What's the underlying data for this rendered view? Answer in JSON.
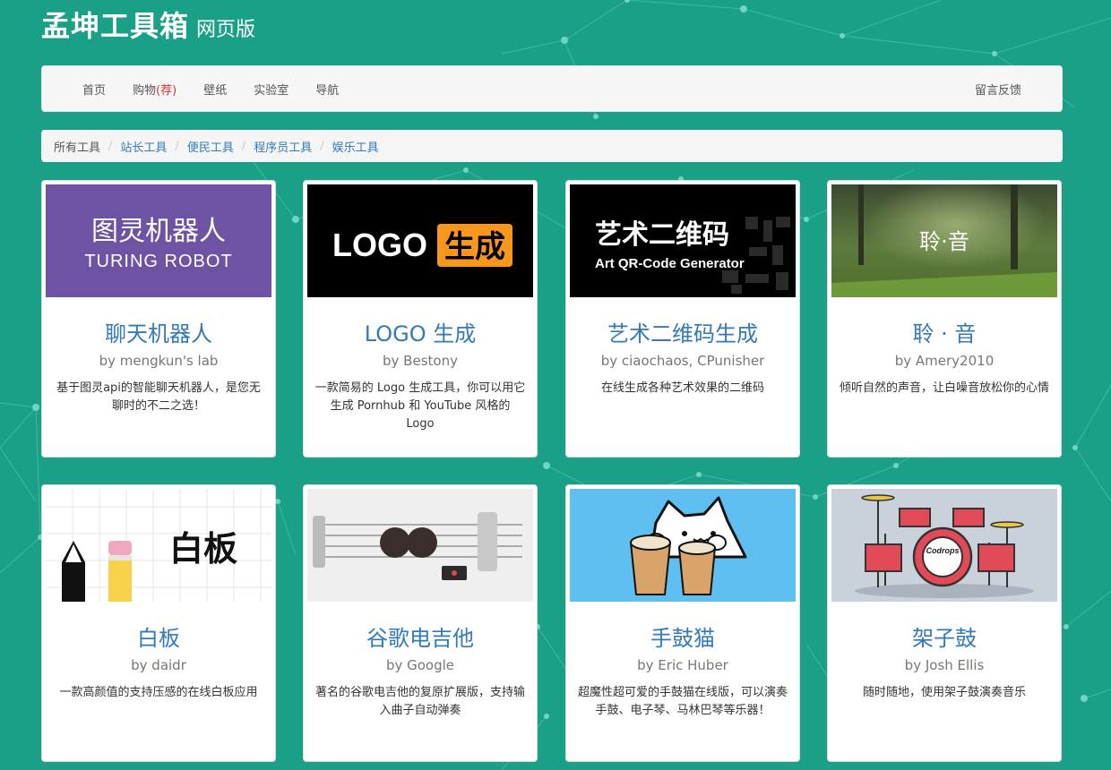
{
  "header": {
    "title": "孟坤工具箱",
    "subtitle": "网页版"
  },
  "nav": {
    "items": [
      {
        "label": "首页"
      },
      {
        "label": "购物",
        "badge": "(荐)"
      },
      {
        "label": "壁纸"
      },
      {
        "label": "实验室"
      },
      {
        "label": "导航"
      }
    ],
    "feedback": "留言反馈"
  },
  "breadcrumb": [
    "所有工具",
    "站长工具",
    "便民工具",
    "程序员工具",
    "娱乐工具"
  ],
  "thumbs": {
    "turing": {
      "line1": "图灵机器人",
      "line2": "TURING ROBOT"
    },
    "logo": {
      "part1": "LOGO",
      "part2": "生成"
    },
    "qr": {
      "line1": "艺术二维码",
      "line2": "Art QR-Code Generator"
    },
    "ling": {
      "text": "聆·音"
    },
    "whiteboard": {
      "text": "白板"
    },
    "drum": {
      "brand": "Codrops"
    }
  },
  "cards": [
    {
      "title": "聊天机器人",
      "author": "by mengkun's lab",
      "desc": "基于图灵api的智能聊天机器人，是您无聊时的不二之选！",
      "icon": "turing-robot-thumbnail"
    },
    {
      "title": "LOGO 生成",
      "author": "by Bestony",
      "desc": "一款简易的 Logo 生成工具，你可以用它生成 Pornhub 和 YouTube 风格的 Logo",
      "icon": "logo-generator-thumbnail"
    },
    {
      "title": "艺术二维码生成",
      "author": "by ciaochaos, CPunisher",
      "desc": "在线生成各种艺术效果的二维码",
      "icon": "art-qrcode-thumbnail"
    },
    {
      "title": "聆 · 音",
      "author": "by Amery2010",
      "desc": "倾听自然的声音，让白噪音放松你的心情",
      "icon": "nature-sound-thumbnail"
    },
    {
      "title": "白板",
      "author": "by daidr",
      "desc": "一款高颜值的支持压感的在线白板应用",
      "icon": "whiteboard-thumbnail"
    },
    {
      "title": "谷歌电吉他",
      "author": "by Google",
      "desc": "著名的谷歌电吉他的复原扩展版，支持输入曲子自动弹奏",
      "icon": "electric-guitar-thumbnail"
    },
    {
      "title": "手鼓猫",
      "author": "by Eric Huber",
      "desc": "超魔性超可爱的手鼓猫在线版，可以演奏手鼓、电子琴、马林巴琴等乐器！",
      "icon": "bongo-cat-thumbnail"
    },
    {
      "title": "架子鼓",
      "author": "by Josh Ellis",
      "desc": "随时随地，使用架子鼓演奏音乐",
      "icon": "drum-kit-thumbnail"
    }
  ],
  "colors": {
    "background": "#1aa086",
    "link": "#337ab7",
    "hot": "#d9302b",
    "logo_orange": "#f7971d",
    "turing_purple": "#6e52a3",
    "bongo_sky": "#5ebff0"
  }
}
